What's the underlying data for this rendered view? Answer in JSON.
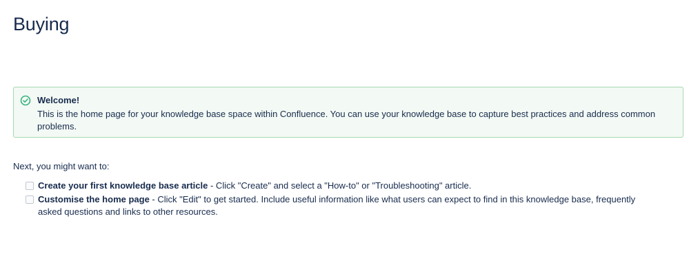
{
  "page": {
    "title": "Buying"
  },
  "panel": {
    "icon": "check-circle-icon",
    "accent_color": "#36b37e",
    "title": "Welcome!",
    "body": "This is the home page for your knowledge base space within Confluence. You can use your knowledge base to capture best practices and address common problems."
  },
  "intro": "Next, you might want to:",
  "tasks": [
    {
      "checked": false,
      "bold": "Create your first knowledge base article",
      "rest": " - Click \"Create\" and select a \"How-to\" or \"Troubleshooting\" article."
    },
    {
      "checked": false,
      "bold": "Customise the home page",
      "rest": " - Click \"Edit\" to get started. Include useful information like what users can expect to find in this knowledge base, frequently asked questions and links to other resources."
    }
  ]
}
